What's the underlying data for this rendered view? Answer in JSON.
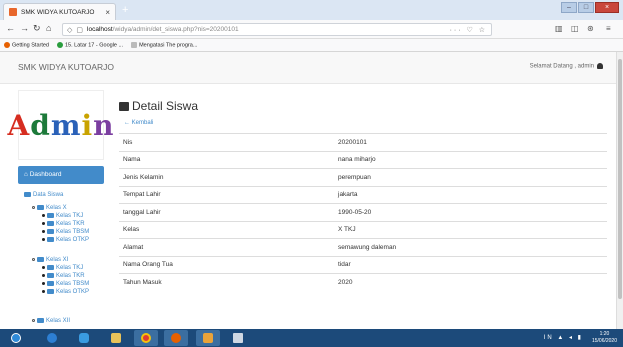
{
  "browser": {
    "tab_title": "SMK WIDYA KUTOARJO",
    "tab_close": "×",
    "new_tab": "+",
    "url_host": "localhost",
    "url_path": "/widya/admin/det_siswa.php?nis=20200101",
    "url_actions": "··· ♡ ☆",
    "bookmarks": [
      "Getting Started",
      "15. Latar 17 - Google ...",
      "Mengatasi The progra..."
    ],
    "window_controls": [
      "–",
      "□",
      "×"
    ]
  },
  "app": {
    "brand": "SMK WIDYA KUTOARJO",
    "welcome": "Selamat Datang , admin",
    "logo_text": "Admin",
    "logo_letter_colors": [
      "#d62d20",
      "#1d7a3a",
      "#2a61b8",
      "#c9a300",
      "#7b3ea0"
    ]
  },
  "sidebar": {
    "dashboard": "Dashboard",
    "data_siswa": "Data Siswa",
    "groups": [
      {
        "label": "Kelas X",
        "items": [
          "Kelas TKJ",
          "Kelas TKR",
          "Kelas TBSM",
          "Kelas OTKP"
        ]
      },
      {
        "label": "Kelas XI",
        "items": [
          "Kelas TKJ",
          "Kelas TKR",
          "Kelas TBSM",
          "Kelas OTKP"
        ]
      },
      {
        "label": "Kelas XII",
        "items": []
      }
    ]
  },
  "main": {
    "title": "Detail Siswa",
    "back_label": "Kembali",
    "rows": [
      {
        "key": "Nis",
        "value": "20200101"
      },
      {
        "key": "Nama",
        "value": "nana miharjo"
      },
      {
        "key": "Jenis Kelamin",
        "value": "perempuan"
      },
      {
        "key": "Tempat Lahir",
        "value": "jakarta"
      },
      {
        "key": "tanggal Lahir",
        "value": "1990-05-20"
      },
      {
        "key": "Kelas",
        "value": "X TKJ"
      },
      {
        "key": "Alamat",
        "value": "semawung daleman"
      },
      {
        "key": "Nama Orang Tua",
        "value": "tidar"
      },
      {
        "key": "Tahun Masuk",
        "value": "2020"
      }
    ]
  },
  "taskbar": {
    "tray": "IN ▲ ◂ ▮",
    "time": "1:20",
    "date": "15/06/2020"
  }
}
